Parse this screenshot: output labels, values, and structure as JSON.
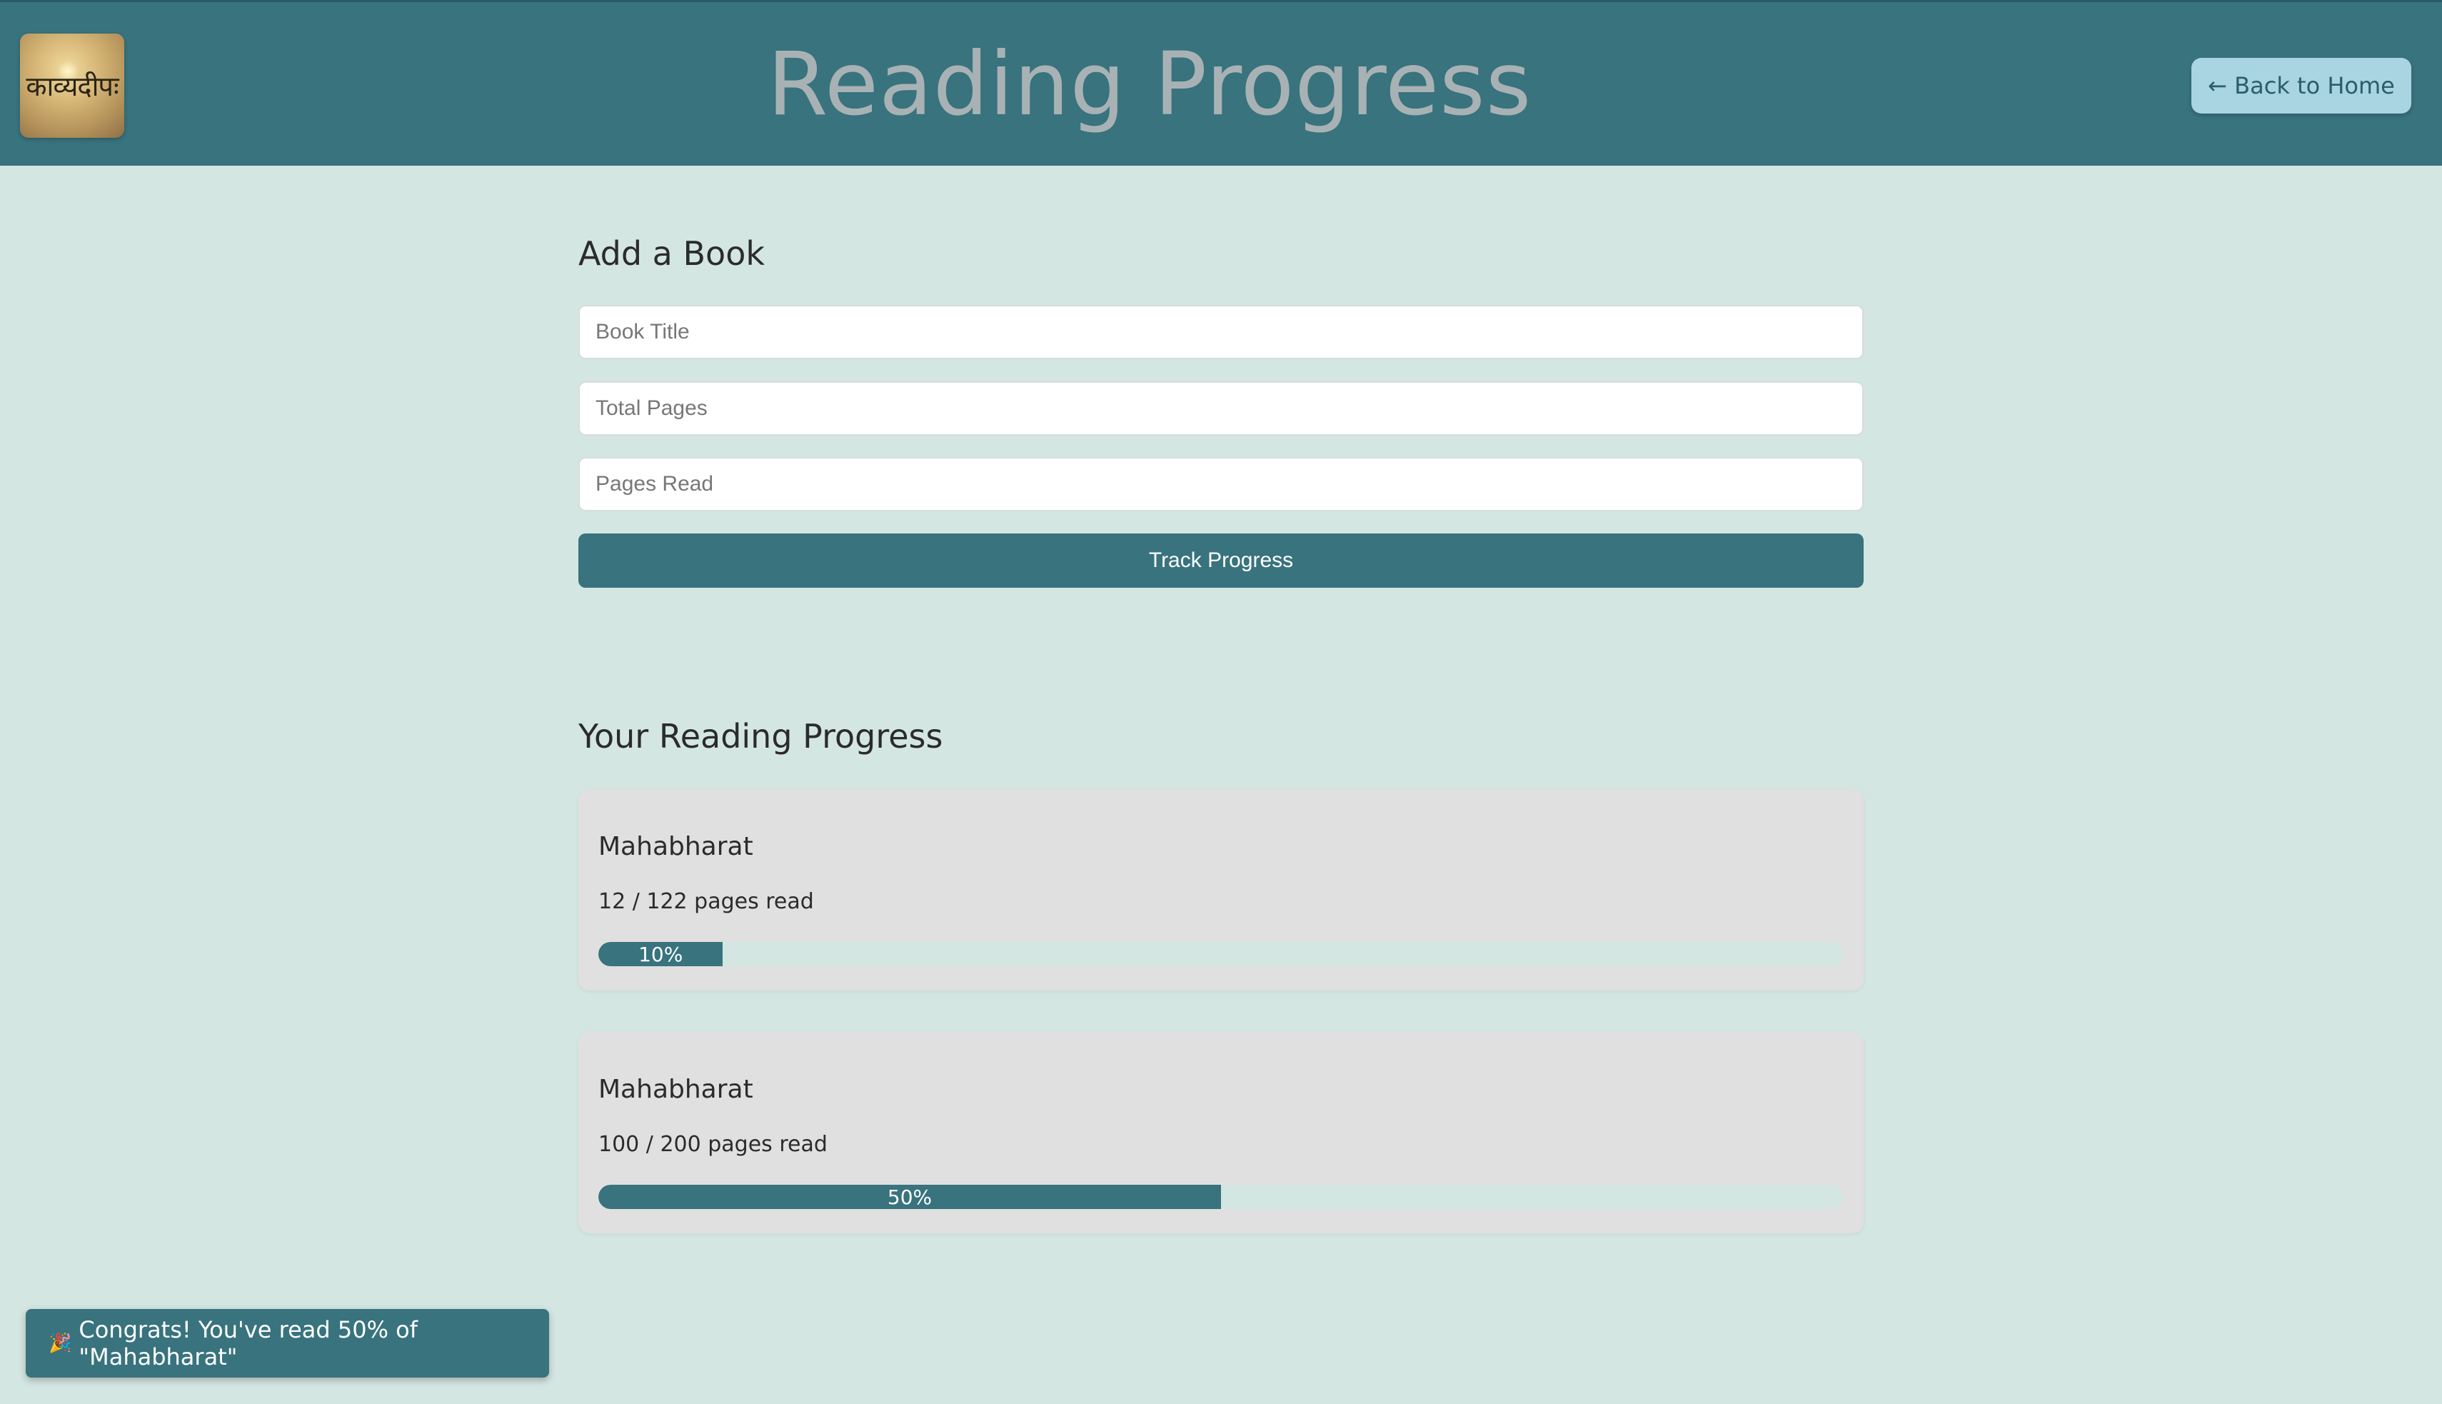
{
  "header": {
    "logo_text": "काव्यदीपः",
    "title": "Reading Progress",
    "back_label": "← Back to Home"
  },
  "add_book": {
    "heading": "Add a Book",
    "title_placeholder": "Book Title",
    "total_placeholder": "Total Pages",
    "read_placeholder": "Pages Read",
    "submit_label": "Track Progress"
  },
  "progress": {
    "heading": "Your Reading Progress",
    "books": [
      {
        "title": "Mahabharat",
        "pages_text": "12 / 122 pages read",
        "percent": 10,
        "percent_label": "10%"
      },
      {
        "title": "Mahabharat",
        "pages_text": "100 / 200 pages read",
        "percent": 50,
        "percent_label": "50%"
      }
    ]
  },
  "toast": {
    "icon": "party-popper-icon",
    "text": "Congrats! You've read 50% of \"Mahabharat\""
  },
  "colors": {
    "primary": "#38737e",
    "background": "#d4e6e2",
    "card": "#e0e0e0",
    "back_button": "#a9d4e2"
  }
}
